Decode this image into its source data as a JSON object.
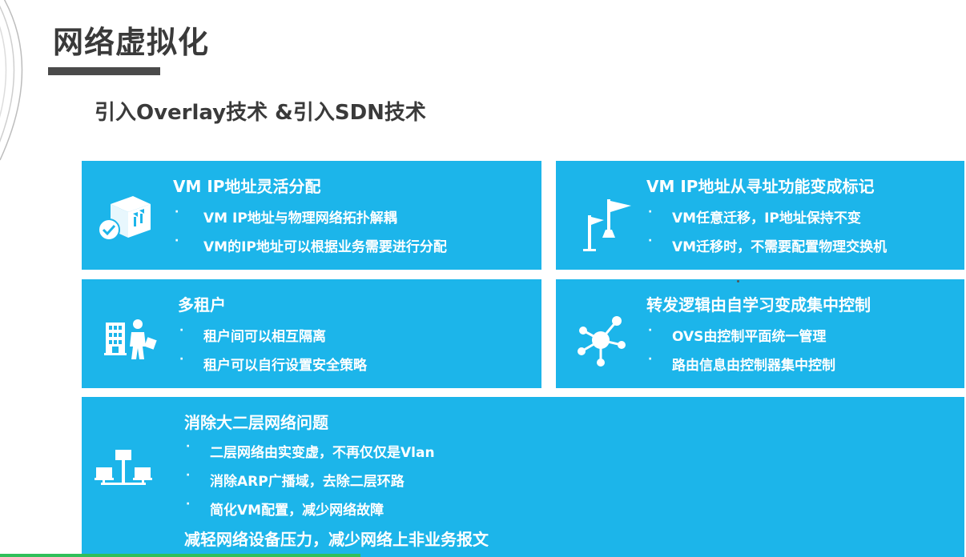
{
  "slide": {
    "title": "网络虚拟化",
    "subtitle": "引入Overlay技术 &引入SDN技术"
  },
  "colors": {
    "card_bg": "#1cb5ea",
    "title_text": "#3a3a3a",
    "accent_bar": "#4a4a4a"
  },
  "cards": [
    {
      "heading": "VM IP地址灵活分配",
      "icon": "package-check-icon",
      "bullets": [
        "VM IP地址与物理网络拓扑解耦",
        "VM的IP地址可以根据业务需要进行分配"
      ]
    },
    {
      "heading": "VM IP地址从寻址功能变成标记",
      "icon": "signpost-icon",
      "bullets": [
        "VM任意迁移，IP地址保持不变",
        "VM迁移时，不需要配置物理交换机"
      ]
    },
    {
      "heading": "多租户",
      "icon": "building-person-icon",
      "bullets": [
        "租户间可以相互隔离",
        "租户可以自行设置安全策略"
      ]
    },
    {
      "heading": "转发逻辑由自学习变成集中控制",
      "icon": "hub-network-icon",
      "bullets": [
        "OVS由控制平面统一管理",
        "路由信息由控制器集中控制"
      ]
    },
    {
      "heading": "消除大二层网络问题",
      "icon": "network-computers-icon",
      "bullets": [
        "二层网络由实变虚，不再仅仅是Vlan",
        "消除ARP广播域，去除二层环路",
        "简化VM配置，减少网络故障"
      ],
      "footer": "减轻网络设备压力，减少网络上非业务报文"
    }
  ],
  "bullet_marker": "·"
}
